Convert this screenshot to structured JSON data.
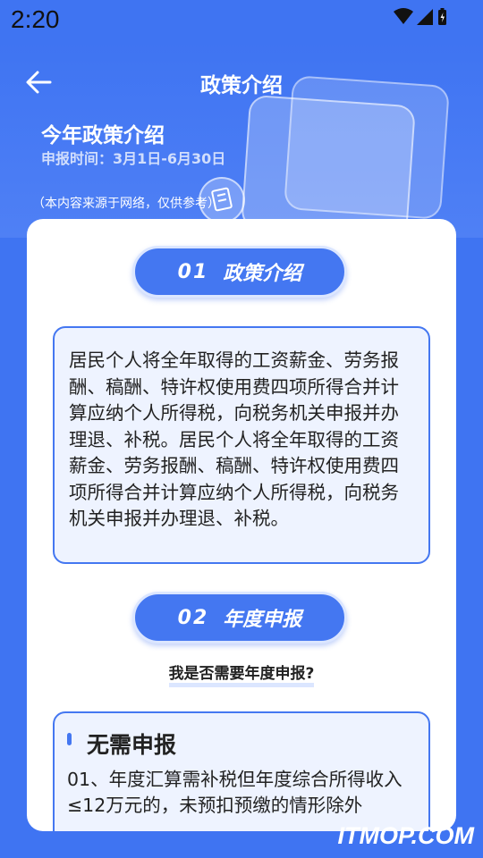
{
  "status_bar": {
    "time": "2:20",
    "icons": [
      "wifi-icon",
      "signal-icon",
      "battery-icon"
    ]
  },
  "nav": {
    "back_icon": "back-arrow-icon",
    "title": "政策介绍"
  },
  "hero": {
    "title": "今年政策介绍",
    "date": "申报时间：3月1日-6月30日",
    "note": "（本内容来源于网络，仅供参考）"
  },
  "section1": {
    "number": "01",
    "title": "政策介绍",
    "body": "居民个人将全年取得的工资薪金、劳务报酬、稿酬、特许权使用费四项所得合并计算应纳个人所得税，向税务机关申报并办理退、补税。居民个人将全年取得的工资薪金、劳务报酬、稿酬、特许权使用费四项所得合并计算应纳个人所得税，向税务机关申报并办理退、补税。"
  },
  "section2": {
    "number": "02",
    "title": "年度申报",
    "question": "我是否需要年度申报?",
    "answer_title": "无需申报",
    "answer_text": "01、年度汇算需补税但年度综合所得收入≤12万元的，未预扣预缴的情形除外"
  },
  "watermark": "ITMOP.COM",
  "colors": {
    "background": "#3f74f2",
    "accent": "#4477f1",
    "box_fill": "#eef3ff",
    "card": "#ffffff"
  }
}
